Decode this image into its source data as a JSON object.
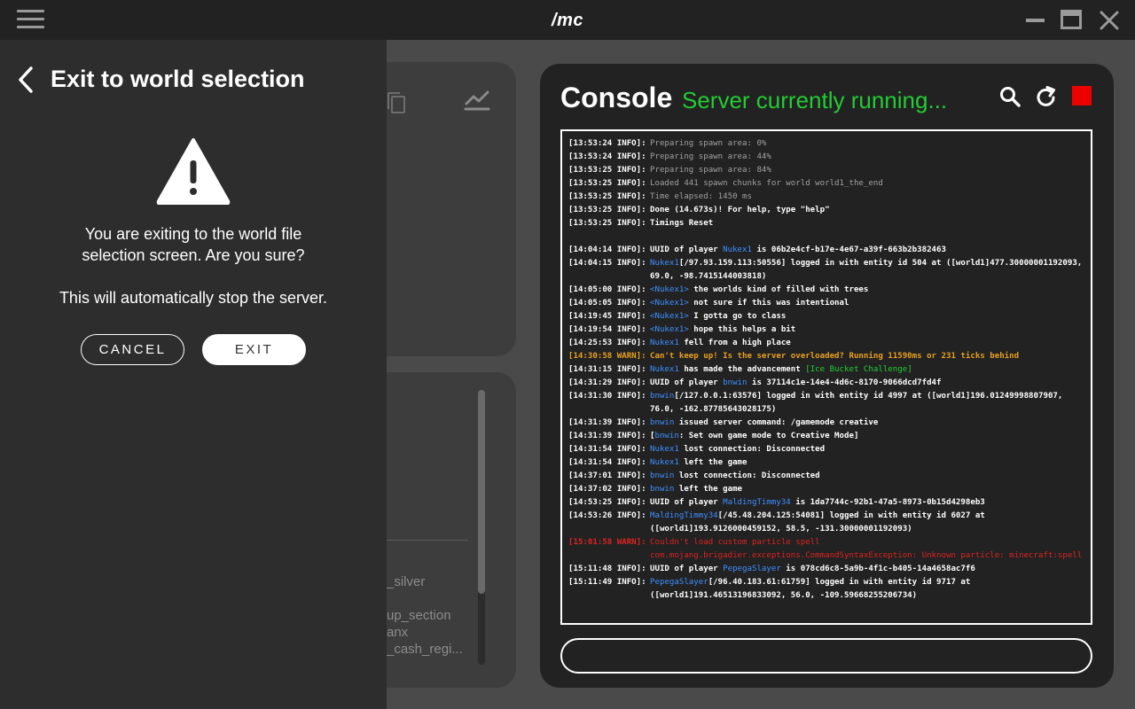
{
  "app": {
    "title": "/mc"
  },
  "drawer": {
    "title": "Exit to world selection",
    "message": "You are exiting to the world file selection screen. Are you sure?",
    "note": "This will automatically stop the server.",
    "cancel_label": "CANCEL",
    "exit_label": "EXIT"
  },
  "background": {
    "items": [
      "_silver",
      "up_section",
      "anx",
      "_cash_regi..."
    ]
  },
  "console": {
    "title": "Console",
    "status": "Server currently running...",
    "status_color": "#22cc33",
    "stop_color": "#ee0000",
    "command_value": "",
    "lines": [
      {
        "ts": "[13:53:24 INFO]:",
        "msg": "Preparing spawn area: 0%"
      },
      {
        "ts": "[13:53:24 INFO]:",
        "msg": "Preparing spawn area: 44%"
      },
      {
        "ts": "[13:53:25 INFO]:",
        "msg": "Preparing spawn area: 84%"
      },
      {
        "ts": "[13:53:25 INFO]:",
        "msg": "Loaded 441 spawn chunks for world world1_the_end"
      },
      {
        "ts": "[13:53:25 INFO]:",
        "msg": "Time elapsed: 1450 ms"
      },
      {
        "ts": "[13:53:25 INFO]:",
        "msg": "Done (14.673s)! For help, type \"help\""
      },
      {
        "ts": "[13:53:25 INFO]:",
        "msg": "Timings Reset"
      },
      {
        "ts": "[14:04:14 INFO]:",
        "msg_pre": "UUID of player ",
        "player": "Nukex1",
        "msg_post": " is 06b2e4cf-b17e-4e67-a39f-663b2b382463"
      },
      {
        "ts": "[14:04:15 INFO]:",
        "player": "Nukex1",
        "msg_post": "[/97.93.159.113:50556] logged in with entity id 504 at ([world1]477.30000001192093,",
        "cont": "69.0, -98.7415144003818)"
      },
      {
        "ts": "[14:05:00 INFO]:",
        "player": "<Nukex1>",
        "msg_post": " the worlds kind of filled with trees"
      },
      {
        "ts": "[14:05:05 INFO]:",
        "player": "<Nukex1>",
        "msg_post": " not sure if this was intentional"
      },
      {
        "ts": "[14:19:45 INFO]:",
        "player": "<Nukex1>",
        "msg_post": " I gotta go to class"
      },
      {
        "ts": "[14:19:54 INFO]:",
        "player": "<Nukex1>",
        "msg_post": " hope this helps a bit"
      },
      {
        "ts": "[14:25:53 INFO]:",
        "player": "Nukex1",
        "msg_post": " fell from a high place"
      },
      {
        "ts": "[14:30:58 WARN]:",
        "msg": "Can't keep up! Is the server overloaded? Running 11590ms or 231 ticks behind"
      },
      {
        "ts": "[14:31:15 INFO]:",
        "player": "Nukex1",
        "msg_mid": " has made the advancement ",
        "adv": "[Ice Bucket Challenge]"
      },
      {
        "ts": "[14:31:29 INFO]:",
        "msg_pre": "UUID of player ",
        "player": "bnwin",
        "msg_post": " is 37114c1e-14e4-4d6c-8170-9066dcd7fd4f"
      },
      {
        "ts": "[14:31:30 INFO]:",
        "player": "bnwin",
        "msg_post": "[/127.0.0.1:63576] logged in with entity id 4997 at ([world1]196.01249998807907,",
        "cont": "76.0, -162.87785643028175)"
      },
      {
        "ts": "[14:31:39 INFO]:",
        "player": "bnwin",
        "msg_post": " issued server command: /gamemode creative"
      },
      {
        "ts": "[14:31:39 INFO]:",
        "msg_pre": "[",
        "player": "bnwin",
        "msg_post": ": Set own game mode to Creative Mode]"
      },
      {
        "ts": "[14:31:54 INFO]:",
        "player": "Nukex1",
        "msg_post": " lost connection: Disconnected"
      },
      {
        "ts": "[14:31:54 INFO]:",
        "player": "Nukex1",
        "msg_post": " left the game"
      },
      {
        "ts": "[14:37:01 INFO]:",
        "player": "bnwin",
        "msg_post": " lost connection: Disconnected"
      },
      {
        "ts": "[14:37:02 INFO]:",
        "player": "bnwin",
        "msg_post": " left the game"
      },
      {
        "ts": "[14:53:25 INFO]:",
        "msg_pre": "UUID of player ",
        "player": "MaldingTimmy34",
        "msg_post": " is 1da7744c-92b1-47a5-8973-0b15d4298eb3"
      },
      {
        "ts": "[14:53:26 INFO]:",
        "player": "MaldingTimmy34",
        "msg_post": "[/45.48.204.125:54081] logged in with entity id 6027 at",
        "cont": "([world1]193.9126000459152, 58.5, -131.30000001192093)"
      },
      {
        "ts": "[15:01:58 WARN]:",
        "msg": "Couldn't load custom particle spell",
        "cont": "com.mojang.brigadier.exceptions.CommandSyntaxException: Unknown particle: minecraft:spell"
      },
      {
        "ts": "[15:11:48 INFO]:",
        "msg_pre": "UUID of player ",
        "player": "PepegaSlayer",
        "msg_post": " is 078cd6c8-5a9b-4f1c-b405-14a4658ac7f6"
      },
      {
        "ts": "[15:11:49 INFO]:",
        "player": "PepegaSlayer",
        "msg_post": "[/96.40.183.61:61759] logged in with entity id 9717 at",
        "cont": "([world1]191.46513196833092, 56.0, -109.59668255206734)"
      }
    ]
  }
}
